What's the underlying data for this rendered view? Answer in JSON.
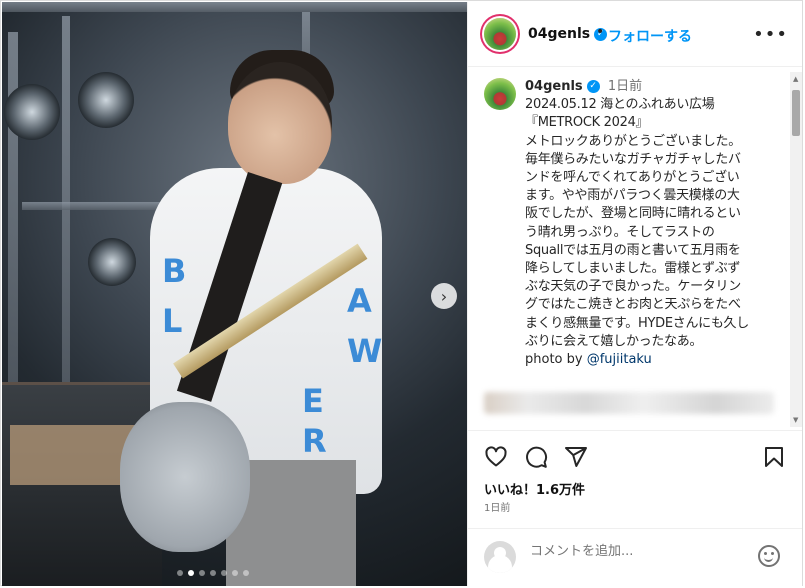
{
  "header": {
    "username": "04genls",
    "separator": "•",
    "follow_label": "フォローする",
    "more_label": "•••"
  },
  "caption": {
    "username": "04genls",
    "time_ago": "1日前",
    "text": "2024.05.12 海とのふれあい広場\n『METROCK 2024』\nメトロックありがとうございました。\n毎年僕らみたいなガチャガチャしたバ\nンドを呼んでくれてありがとうござい\nます。やや雨がパラつく曇天模様の大\n阪でしたが、登場と同時に晴れるとい\nう晴れ男っぷり。そしてラストの\nSquallでは五月の雨と書いて五月雨を\n降らしてしまいました。雷様とずぶず\nぶな天気の子で良かった。ケータリン\nグではたこ焼きとお肉と天ぷらをたべ\nまくり感無量です。HYDEさんにも久し\nぶりに会えて嬉しかったなあ。",
    "photo_by_label": "photo by ",
    "mention": "@fujiitaku"
  },
  "actions": {
    "likes_text": "いいね！1.6万件",
    "time_ago": "1日前"
  },
  "comment": {
    "placeholder": "コメントを追加..."
  },
  "carousel": {
    "slide_count": 7,
    "active_index": 1
  },
  "colors": {
    "accent_blue": "#0095f6",
    "mention_blue": "#00376b",
    "muted": "#737373",
    "story_ring": "#e1306c"
  },
  "icons": [
    "heart-icon",
    "comment-icon",
    "share-icon",
    "bookmark-icon",
    "next-arrow-icon",
    "verified-badge-icon",
    "emoji-icon",
    "more-options-icon"
  ]
}
